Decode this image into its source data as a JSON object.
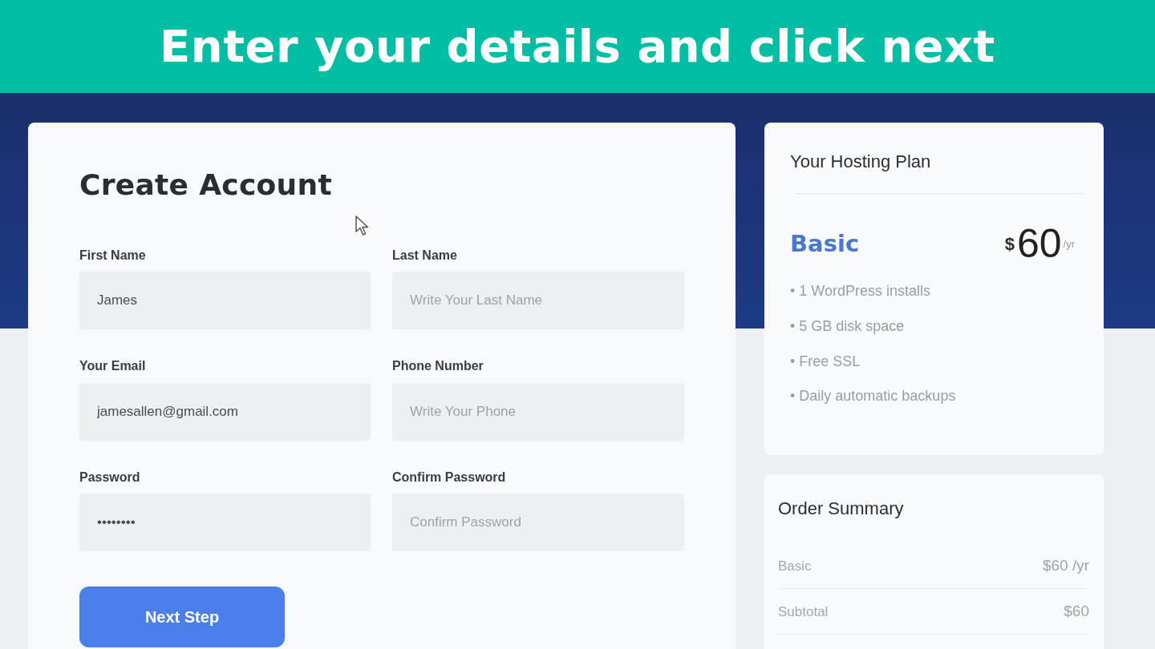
{
  "banner": {
    "text": "Enter your details and click next"
  },
  "form": {
    "title": "Create Account",
    "fields": [
      {
        "label": "First Name",
        "value": "James"
      },
      {
        "label": "Last Name",
        "placeholder": "Write Your Last Name"
      },
      {
        "label": "Your Email",
        "value": "jamesallen@gmail.com"
      },
      {
        "label": "Phone Number",
        "placeholder": "Write Your Phone"
      },
      {
        "label": "Password",
        "value": "••••••••"
      },
      {
        "label": "Confirm Password",
        "placeholder": "Confirm Password"
      }
    ],
    "submit": "Next Step"
  },
  "plan": {
    "title": "Your Hosting Plan",
    "name": "Basic",
    "price": {
      "currency": "$",
      "amount": "60",
      "period": "/yr"
    },
    "features": [
      "• 1 WordPress installs",
      "• 5 GB disk space",
      "• Free SSL",
      "• Daily automatic backups"
    ]
  },
  "order_summary": {
    "title": "Order Summary",
    "rows": [
      {
        "label": "Basic",
        "value": "$60 /yr"
      },
      {
        "label": "Subtotal",
        "value": "$60"
      }
    ]
  }
}
